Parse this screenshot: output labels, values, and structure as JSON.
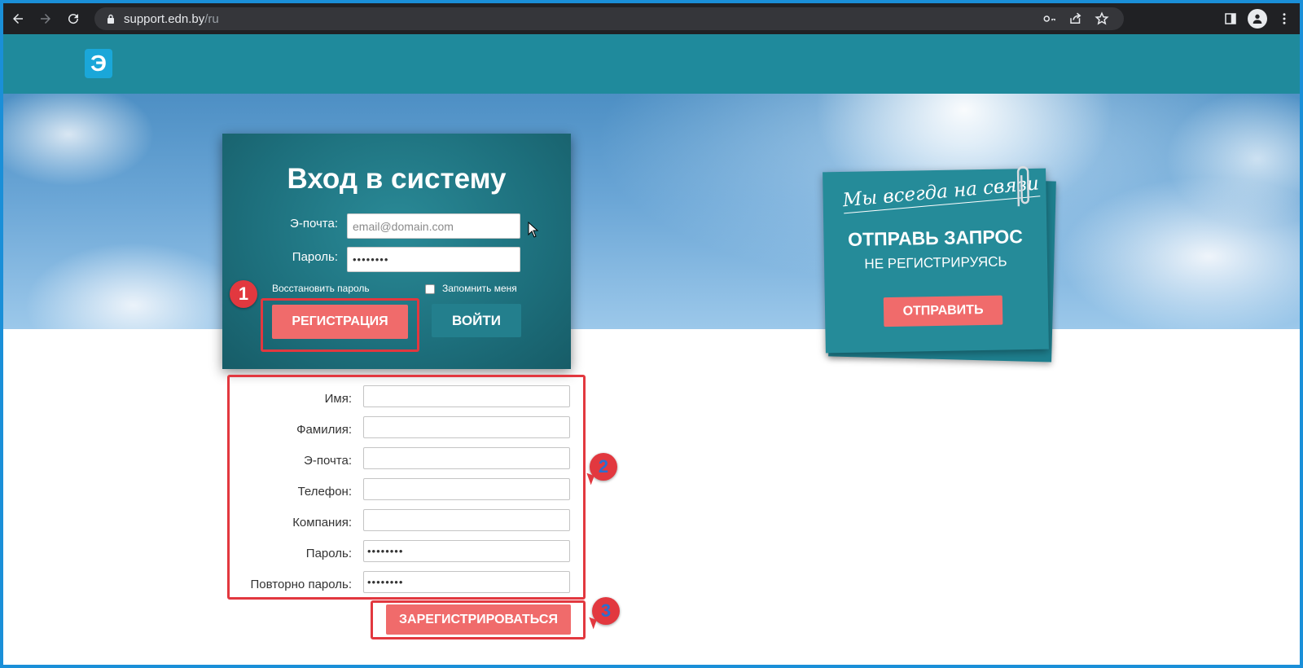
{
  "browser": {
    "url_host": "support.edn.by",
    "url_path": "/ru"
  },
  "site": {
    "logo_text": "Э"
  },
  "login": {
    "title": "Вход в систему",
    "email_label": "Э-почта:",
    "email_placeholder": "email@domain.com",
    "password_label": "Пароль:",
    "password_value": "••••••••",
    "restore_link": "Восстановить пароль",
    "remember_label": "Запомнить меня",
    "register_button": "РЕГИСТРАЦИЯ",
    "login_button": "ВОЙТИ"
  },
  "note": {
    "handwritten": "Мы всегда на связи",
    "title": "ОТПРАВЬ ЗАПРОС",
    "subtitle": "НЕ РЕГИСТРИРУЯСЬ",
    "send_button": "ОТПРАВИТЬ"
  },
  "registration": {
    "fields": [
      {
        "label": "Имя:",
        "value": ""
      },
      {
        "label": "Фамилия:",
        "value": ""
      },
      {
        "label": "Э-почта:",
        "value": ""
      },
      {
        "label": "Телефон:",
        "value": ""
      },
      {
        "label": "Компания:",
        "value": ""
      },
      {
        "label": "Пароль:",
        "value": "••••••••"
      },
      {
        "label": "Повторно пароль:",
        "value": "••••••••"
      }
    ],
    "submit_button": "ЗАРЕГИСТРИРОВАТЬСЯ"
  },
  "annotations": {
    "badge_1": "1",
    "badge_2": "2",
    "badge_3": "3"
  }
}
